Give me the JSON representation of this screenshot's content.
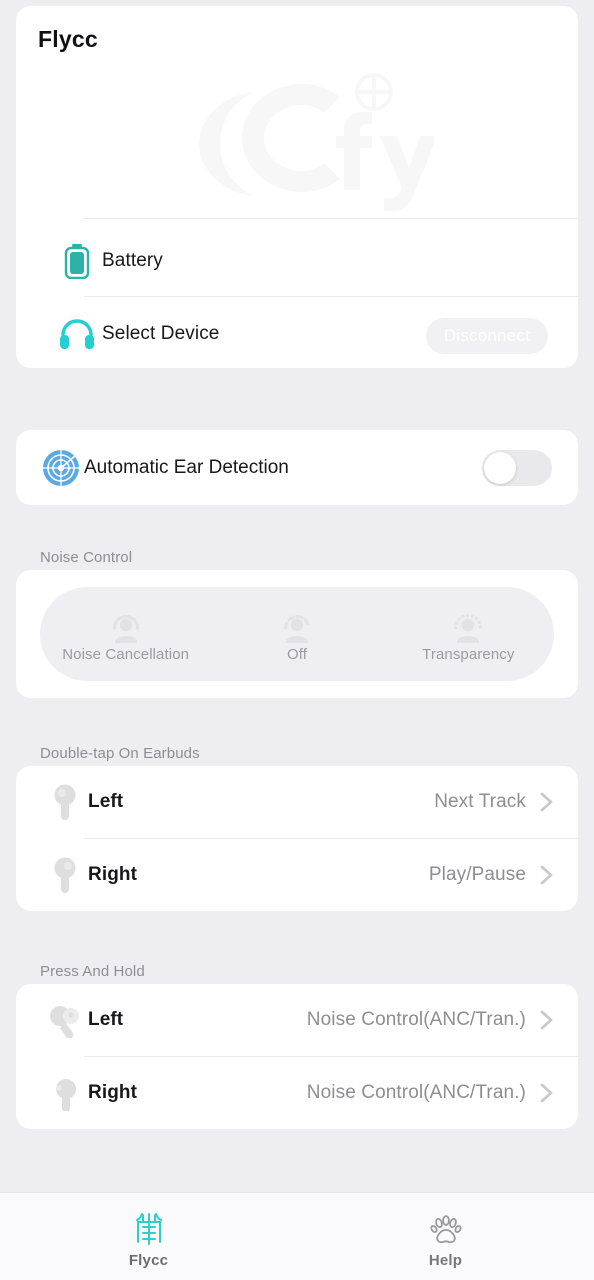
{
  "app": {
    "title": "Flycc",
    "brand_teal": "#22c9c0",
    "accent_blue": "#4a9fe0",
    "background": "#eeeef2",
    "card_background": "#ffffff",
    "muted_text": "#8d8d93",
    "watermark_text": "fly"
  },
  "device_card": {
    "rows": [
      {
        "icon": "battery-icon",
        "label": "Battery",
        "value": ""
      },
      {
        "icon": "headphone-icon",
        "label": "Select Device",
        "value": ""
      }
    ],
    "disconnect_label": "Disconnect"
  },
  "ear_detection": {
    "icon": "radar-target-icon",
    "label": "Automatic Ear Detection",
    "toggle_on": false
  },
  "noise_control": {
    "section_label": "Noise Control",
    "selected": null,
    "options": [
      {
        "icon": "person-solid-ring-icon",
        "label": "Noise Cancellation"
      },
      {
        "icon": "person-dashed-ring-icon",
        "label": "Off"
      },
      {
        "icon": "person-dotted-ring-icon",
        "label": "Transparency"
      }
    ]
  },
  "double_tap": {
    "section_label": "Double-tap On Earbuds",
    "rows": [
      {
        "icon": "earbud-left-icon",
        "label": "Left",
        "value": "Next Track"
      },
      {
        "icon": "earbud-right-icon",
        "label": "Right",
        "value": "Play/Pause"
      }
    ]
  },
  "press_and_hold": {
    "section_label": "Press And Hold",
    "rows": [
      {
        "icon": "earbud-press-left-icon",
        "label": "Left",
        "value": "Noise Control(ANC/Tran.)"
      },
      {
        "icon": "earbud-press-right-icon",
        "label": "Right",
        "value": "Noise Control(ANC/Tran.)"
      }
    ]
  },
  "tabbar": {
    "tabs": [
      {
        "icon": "flycc-glyph-icon",
        "label": "Flycc",
        "active": true
      },
      {
        "icon": "paw-print-icon",
        "label": "Help",
        "active": false
      }
    ]
  }
}
